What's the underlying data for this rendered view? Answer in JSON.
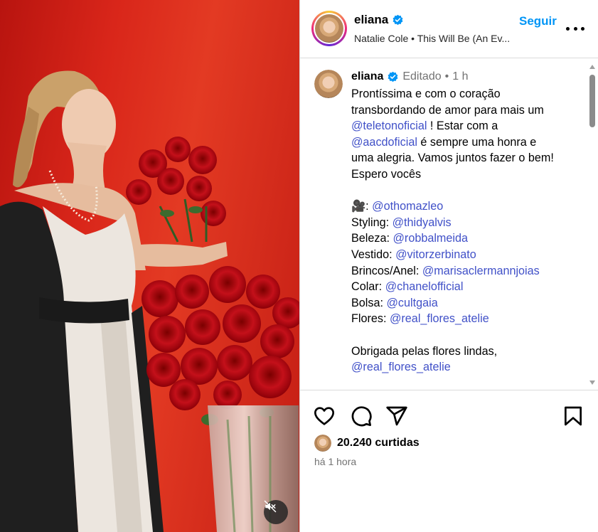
{
  "header": {
    "username": "eliana",
    "song": "Natalie Cole • This Will Be (An Ev...",
    "follow_label": "Seguir"
  },
  "caption": {
    "username": "eliana",
    "edited": "Editado",
    "dot": "•",
    "time": "1 h",
    "lines": [
      {
        "text": "Prontíssima e com o coração",
        "mention": ""
      },
      {
        "text": "transbordando de amor para mais um",
        "mention": ""
      },
      {
        "mention": "@teletonoficial",
        "text": " ! Estar com a"
      },
      {
        "mention": "@aacdoficial",
        "text": " é sempre uma honra e"
      },
      {
        "text": "uma alegria. Vamos juntos fazer o bem!",
        "mention": ""
      },
      {
        "text": "Espero vocês",
        "mention": ""
      }
    ],
    "credits": [
      {
        "label": "🎥: ",
        "mention": "@othomazleo"
      },
      {
        "label": "Styling: ",
        "mention": "@thidyalvis"
      },
      {
        "label": "Beleza: ",
        "mention": "@robbalmeida"
      },
      {
        "label": "Vestido: ",
        "mention": "@vitorzerbinato"
      },
      {
        "label": "Brincos/Anel: ",
        "mention": "@marisaclermannjoias"
      },
      {
        "label": "Colar: ",
        "mention": "@chanelofficial"
      },
      {
        "label": "Bolsa: ",
        "mention": "@cultgaia"
      },
      {
        "label": "Flores: ",
        "mention": "@real_flores_atelie"
      }
    ],
    "thanks": "Obrigada pelas flores lindas,",
    "thanks_mention": "@real_flores_atelie"
  },
  "stats": {
    "likes": "20.240 curtidas",
    "posted": "há 1 hora"
  },
  "icons": [
    "verified-badge-icon",
    "more-options-icon",
    "heart-icon",
    "comment-icon",
    "share-icon",
    "bookmark-icon",
    "mute-icon"
  ],
  "colors": {
    "accent": "#0095f6",
    "mention": "#4151c8",
    "muted": "#737373",
    "background_red": "#d9261a"
  }
}
